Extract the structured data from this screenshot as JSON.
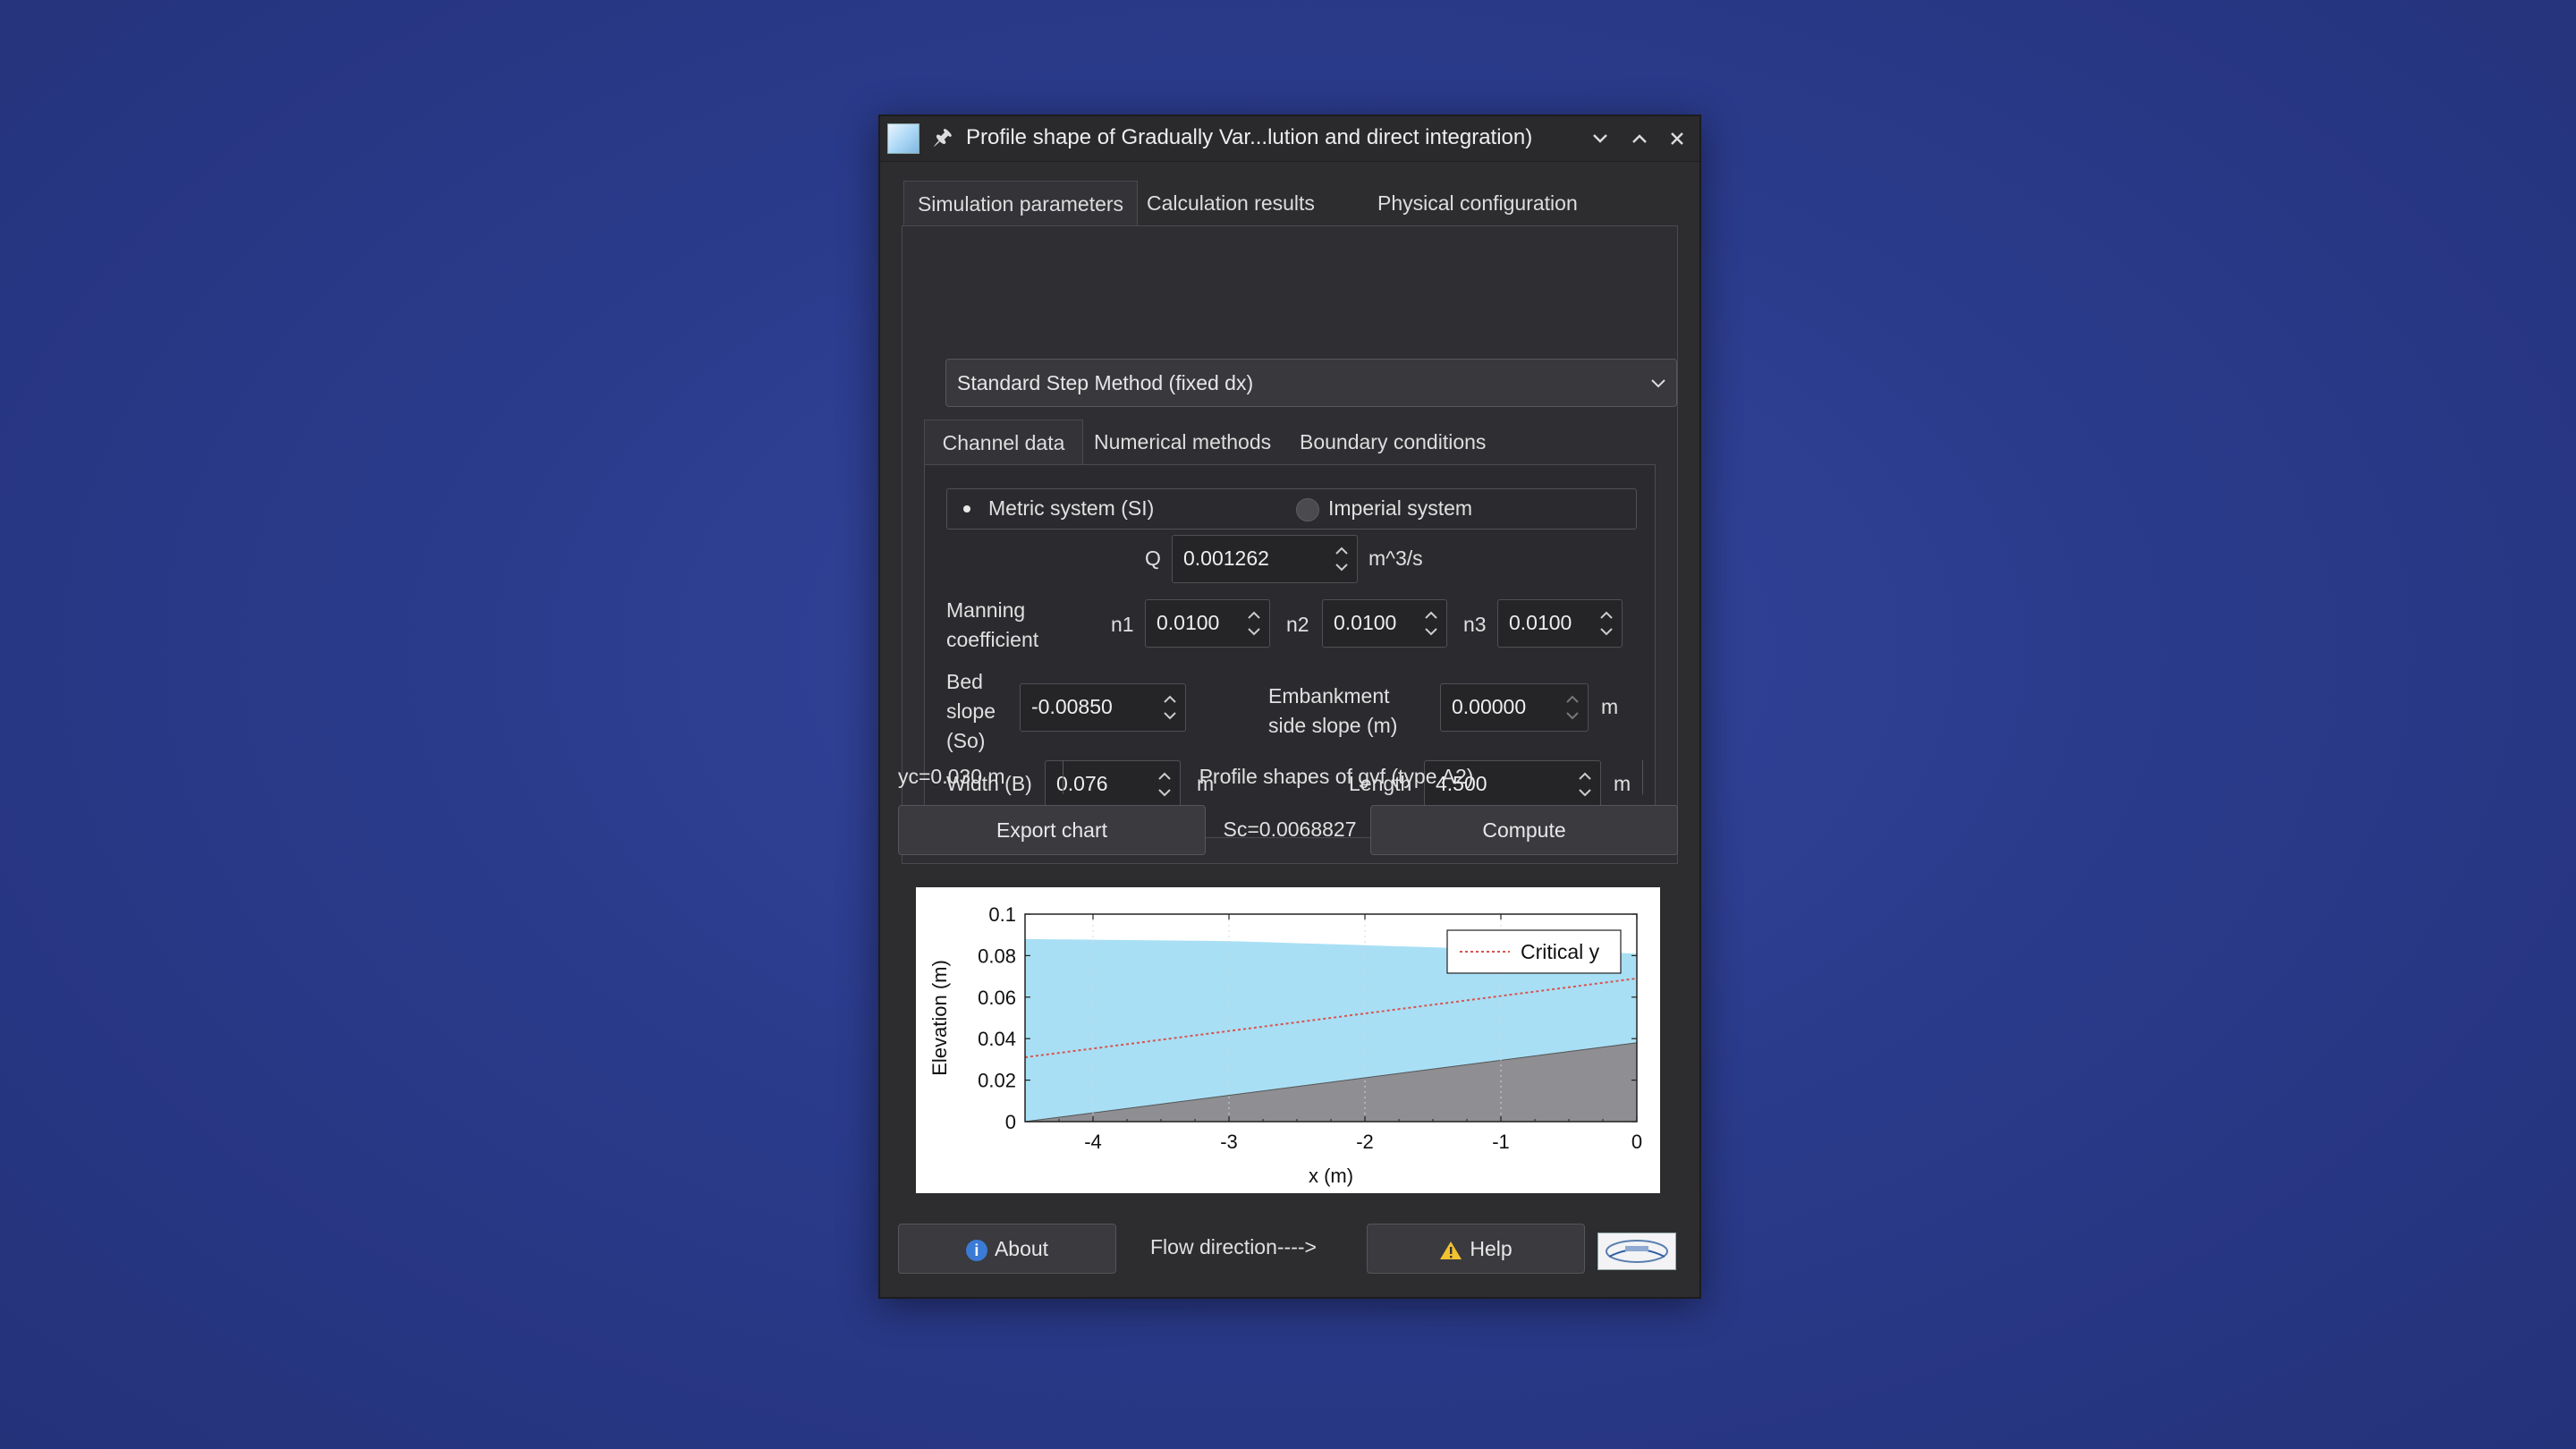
{
  "window": {
    "title": "Profile shape of Gradually Var...lution and direct integration)"
  },
  "main_tabs": [
    "Simulation parameters",
    "Calculation results",
    "Physical configuration"
  ],
  "method_select": {
    "value": "Standard Step Method (fixed dx)"
  },
  "sub_tabs": [
    "Channel data",
    "Numerical methods",
    "Boundary conditions"
  ],
  "units": {
    "metric_label": "Metric system (SI)",
    "imperial_label": "Imperial system",
    "selected": "metric"
  },
  "params": {
    "q_label": "Q",
    "q_value": "0.001262",
    "q_unit": "m^3/s",
    "manning_label": "Manning coefficient",
    "n1_label": "n1",
    "n1_value": "0.0100",
    "n2_label": "n2",
    "n2_value": "0.0100",
    "n3_label": "n3",
    "n3_value": "0.0100",
    "bed_slope_label": "Bed slope (So)",
    "bed_slope_value": "-0.00850",
    "embankment_label": "Embankment side slope (m)",
    "embankment_value": "0.00000",
    "embankment_unit": "m",
    "width_label": "Width (B)",
    "width_value": "0.076",
    "width_unit": "m",
    "length_label": "Length",
    "length_value": "4.500",
    "length_unit": "m"
  },
  "status": {
    "yc": "yc=0.030  m",
    "profile_type": "Profile shapes of gvf (type A2)",
    "sc": "Sc=0.0068827"
  },
  "buttons": {
    "export": "Export chart",
    "compute": "Compute",
    "about": "About",
    "help": "Help"
  },
  "flow_direction": "Flow direction---->",
  "chart_data": {
    "type": "area",
    "title": "",
    "xlabel": "x (m)",
    "ylabel": "Elevation (m)",
    "xlim": [
      -4.5,
      0
    ],
    "ylim": [
      0,
      0.1
    ],
    "x_ticks": [
      -4,
      -3,
      -2,
      -1,
      0
    ],
    "y_ticks": [
      0,
      0.02,
      0.04,
      0.06,
      0.08,
      0.1
    ],
    "y_tick_labels": [
      "0",
      "0.02",
      "0.04",
      "0.06",
      "0.08",
      "0.1"
    ],
    "legend": {
      "entries": [
        "Critical y"
      ],
      "position": "top-right"
    },
    "series": [
      {
        "kind": "bed",
        "color": "#8e8e93",
        "x": [
          -4.5,
          0
        ],
        "y": [
          0,
          0.038
        ]
      },
      {
        "kind": "water-surface",
        "color": "#a8dff5",
        "x": [
          -4.5,
          -3,
          -2,
          -1,
          0
        ],
        "y": [
          0.088,
          0.087,
          0.085,
          0.083,
          0.081
        ]
      },
      {
        "name": "Critical y",
        "kind": "critical",
        "color": "#d9534f",
        "x": [
          -4.5,
          0
        ],
        "y": [
          0.031,
          0.069
        ]
      }
    ]
  }
}
